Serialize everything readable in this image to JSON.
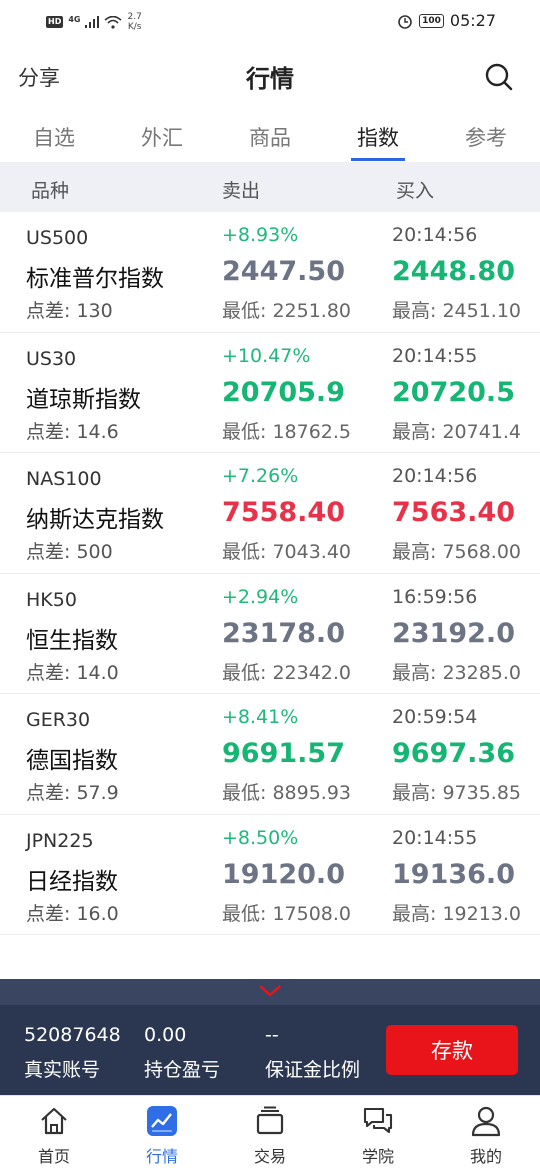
{
  "status_bar": {
    "hd": "HD",
    "network": "4G",
    "speed_value": "2.7",
    "speed_unit": "K/s",
    "battery": "100",
    "time": "05:27"
  },
  "header": {
    "share_label": "分享",
    "title": "行情",
    "search_icon": "search-icon"
  },
  "tabs": [
    {
      "label": "自选",
      "active": false
    },
    {
      "label": "外汇",
      "active": false
    },
    {
      "label": "商品",
      "active": false
    },
    {
      "label": "指数",
      "active": true
    },
    {
      "label": "参考",
      "active": false
    }
  ],
  "columns": {
    "name": "品种",
    "sell": "卖出",
    "buy": "买入"
  },
  "rows": [
    {
      "symbol": "US500",
      "name": "标准普尔指数",
      "spread": "点差: 130",
      "change": "+8.93%",
      "sell": "2447.50",
      "sell_color": "grey",
      "low": "最低: 2251.80",
      "time": "20:14:56",
      "buy": "2448.80",
      "buy_color": "green",
      "high": "最高: 2451.10"
    },
    {
      "symbol": "US30",
      "name": "道琼斯指数",
      "spread": "点差: 14.6",
      "change": "+10.47%",
      "sell": "20705.9",
      "sell_color": "green",
      "low": "最低: 18762.5",
      "time": "20:14:55",
      "buy": "20720.5",
      "buy_color": "green",
      "high": "最高: 20741.4"
    },
    {
      "symbol": "NAS100",
      "name": "纳斯达克指数",
      "spread": "点差: 500",
      "change": "+7.26%",
      "sell": "7558.40",
      "sell_color": "red",
      "low": "最低: 7043.40",
      "time": "20:14:56",
      "buy": "7563.40",
      "buy_color": "red",
      "high": "最高: 7568.00"
    },
    {
      "symbol": "HK50",
      "name": "恒生指数",
      "spread": "点差: 14.0",
      "change": "+2.94%",
      "sell": "23178.0",
      "sell_color": "grey",
      "low": "最低: 22342.0",
      "time": "16:59:56",
      "buy": "23192.0",
      "buy_color": "grey",
      "high": "最高: 23285.0"
    },
    {
      "symbol": "GER30",
      "name": "德国指数",
      "spread": "点差: 57.9",
      "change": "+8.41%",
      "sell": "9691.57",
      "sell_color": "green",
      "low": "最低: 8895.93",
      "time": "20:59:54",
      "buy": "9697.36",
      "buy_color": "green",
      "high": "最高: 9735.85"
    },
    {
      "symbol": "JPN225",
      "name": "日经指数",
      "spread": "点差: 16.0",
      "change": "+8.50%",
      "sell": "19120.0",
      "sell_color": "grey",
      "low": "最低: 17508.0",
      "time": "20:14:55",
      "buy": "19136.0",
      "buy_color": "grey",
      "high": "最高: 19213.0"
    }
  ],
  "colors": {
    "grey": "#6b7384",
    "green": "#15b573",
    "red": "#e8324a",
    "accent": "#2f6ee6",
    "deposit": "#e8141a"
  },
  "account": {
    "account_no": "52087648",
    "account_label": "真实账号",
    "pnl": "0.00",
    "pnl_label": "持仓盈亏",
    "margin": "--",
    "margin_label": "保证金比例",
    "deposit_label": "存款"
  },
  "bottom_nav": [
    {
      "label": "首页",
      "icon": "home-icon",
      "active": false
    },
    {
      "label": "行情",
      "icon": "chart-icon",
      "active": true
    },
    {
      "label": "交易",
      "icon": "trade-icon",
      "active": false
    },
    {
      "label": "学院",
      "icon": "chat-icon",
      "active": false
    },
    {
      "label": "我的",
      "icon": "user-icon",
      "active": false
    }
  ]
}
